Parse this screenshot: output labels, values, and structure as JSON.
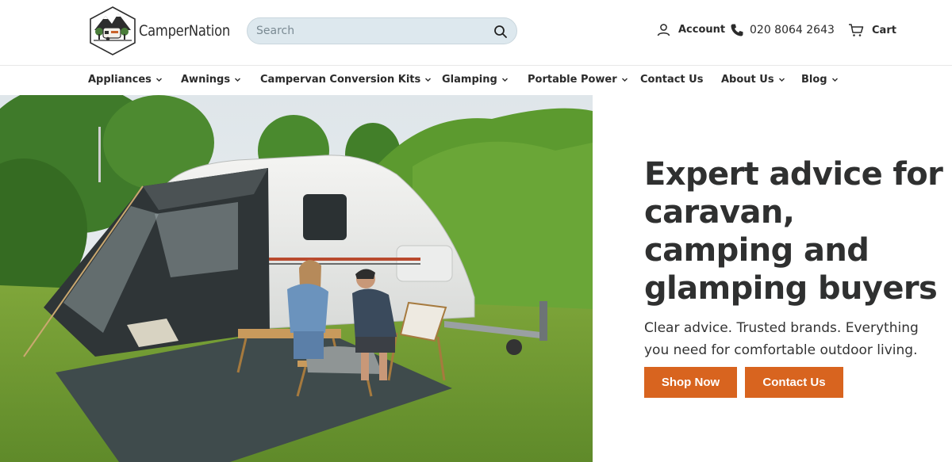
{
  "brand": {
    "name": "CamperNation"
  },
  "search": {
    "placeholder": "Search"
  },
  "header": {
    "account_label": "Account",
    "phone": "020 8064 2643",
    "cart_label": "Cart"
  },
  "nav": {
    "items": [
      {
        "label": "Appliances",
        "has_dropdown": true
      },
      {
        "label": "Awnings",
        "has_dropdown": true
      },
      {
        "label": "Campervan Conversion Kits",
        "has_dropdown": true
      },
      {
        "label": "Glamping",
        "has_dropdown": true
      },
      {
        "label": "Portable Power",
        "has_dropdown": true
      },
      {
        "label": "Contact Us",
        "has_dropdown": false
      },
      {
        "label": "About Us",
        "has_dropdown": true
      },
      {
        "label": "Blog",
        "has_dropdown": true
      }
    ]
  },
  "hero": {
    "headline_lines": [
      "Expert advice for",
      "caravan,",
      "camping and",
      "glamping buyers"
    ],
    "sub_lines": [
      "Clear advice. Trusted brands. Everything",
      "you need for comfortable outdoor living."
    ],
    "primary_cta": "Shop Now",
    "secondary_cta": "Contact Us"
  },
  "colors": {
    "accent": "#d8641f",
    "search_bg": "#dde8ee",
    "text": "#2b2b2b"
  },
  "icons": [
    "logo-icon",
    "search-icon",
    "account-icon",
    "phone-icon",
    "cart-icon",
    "chevron-down-icon"
  ]
}
